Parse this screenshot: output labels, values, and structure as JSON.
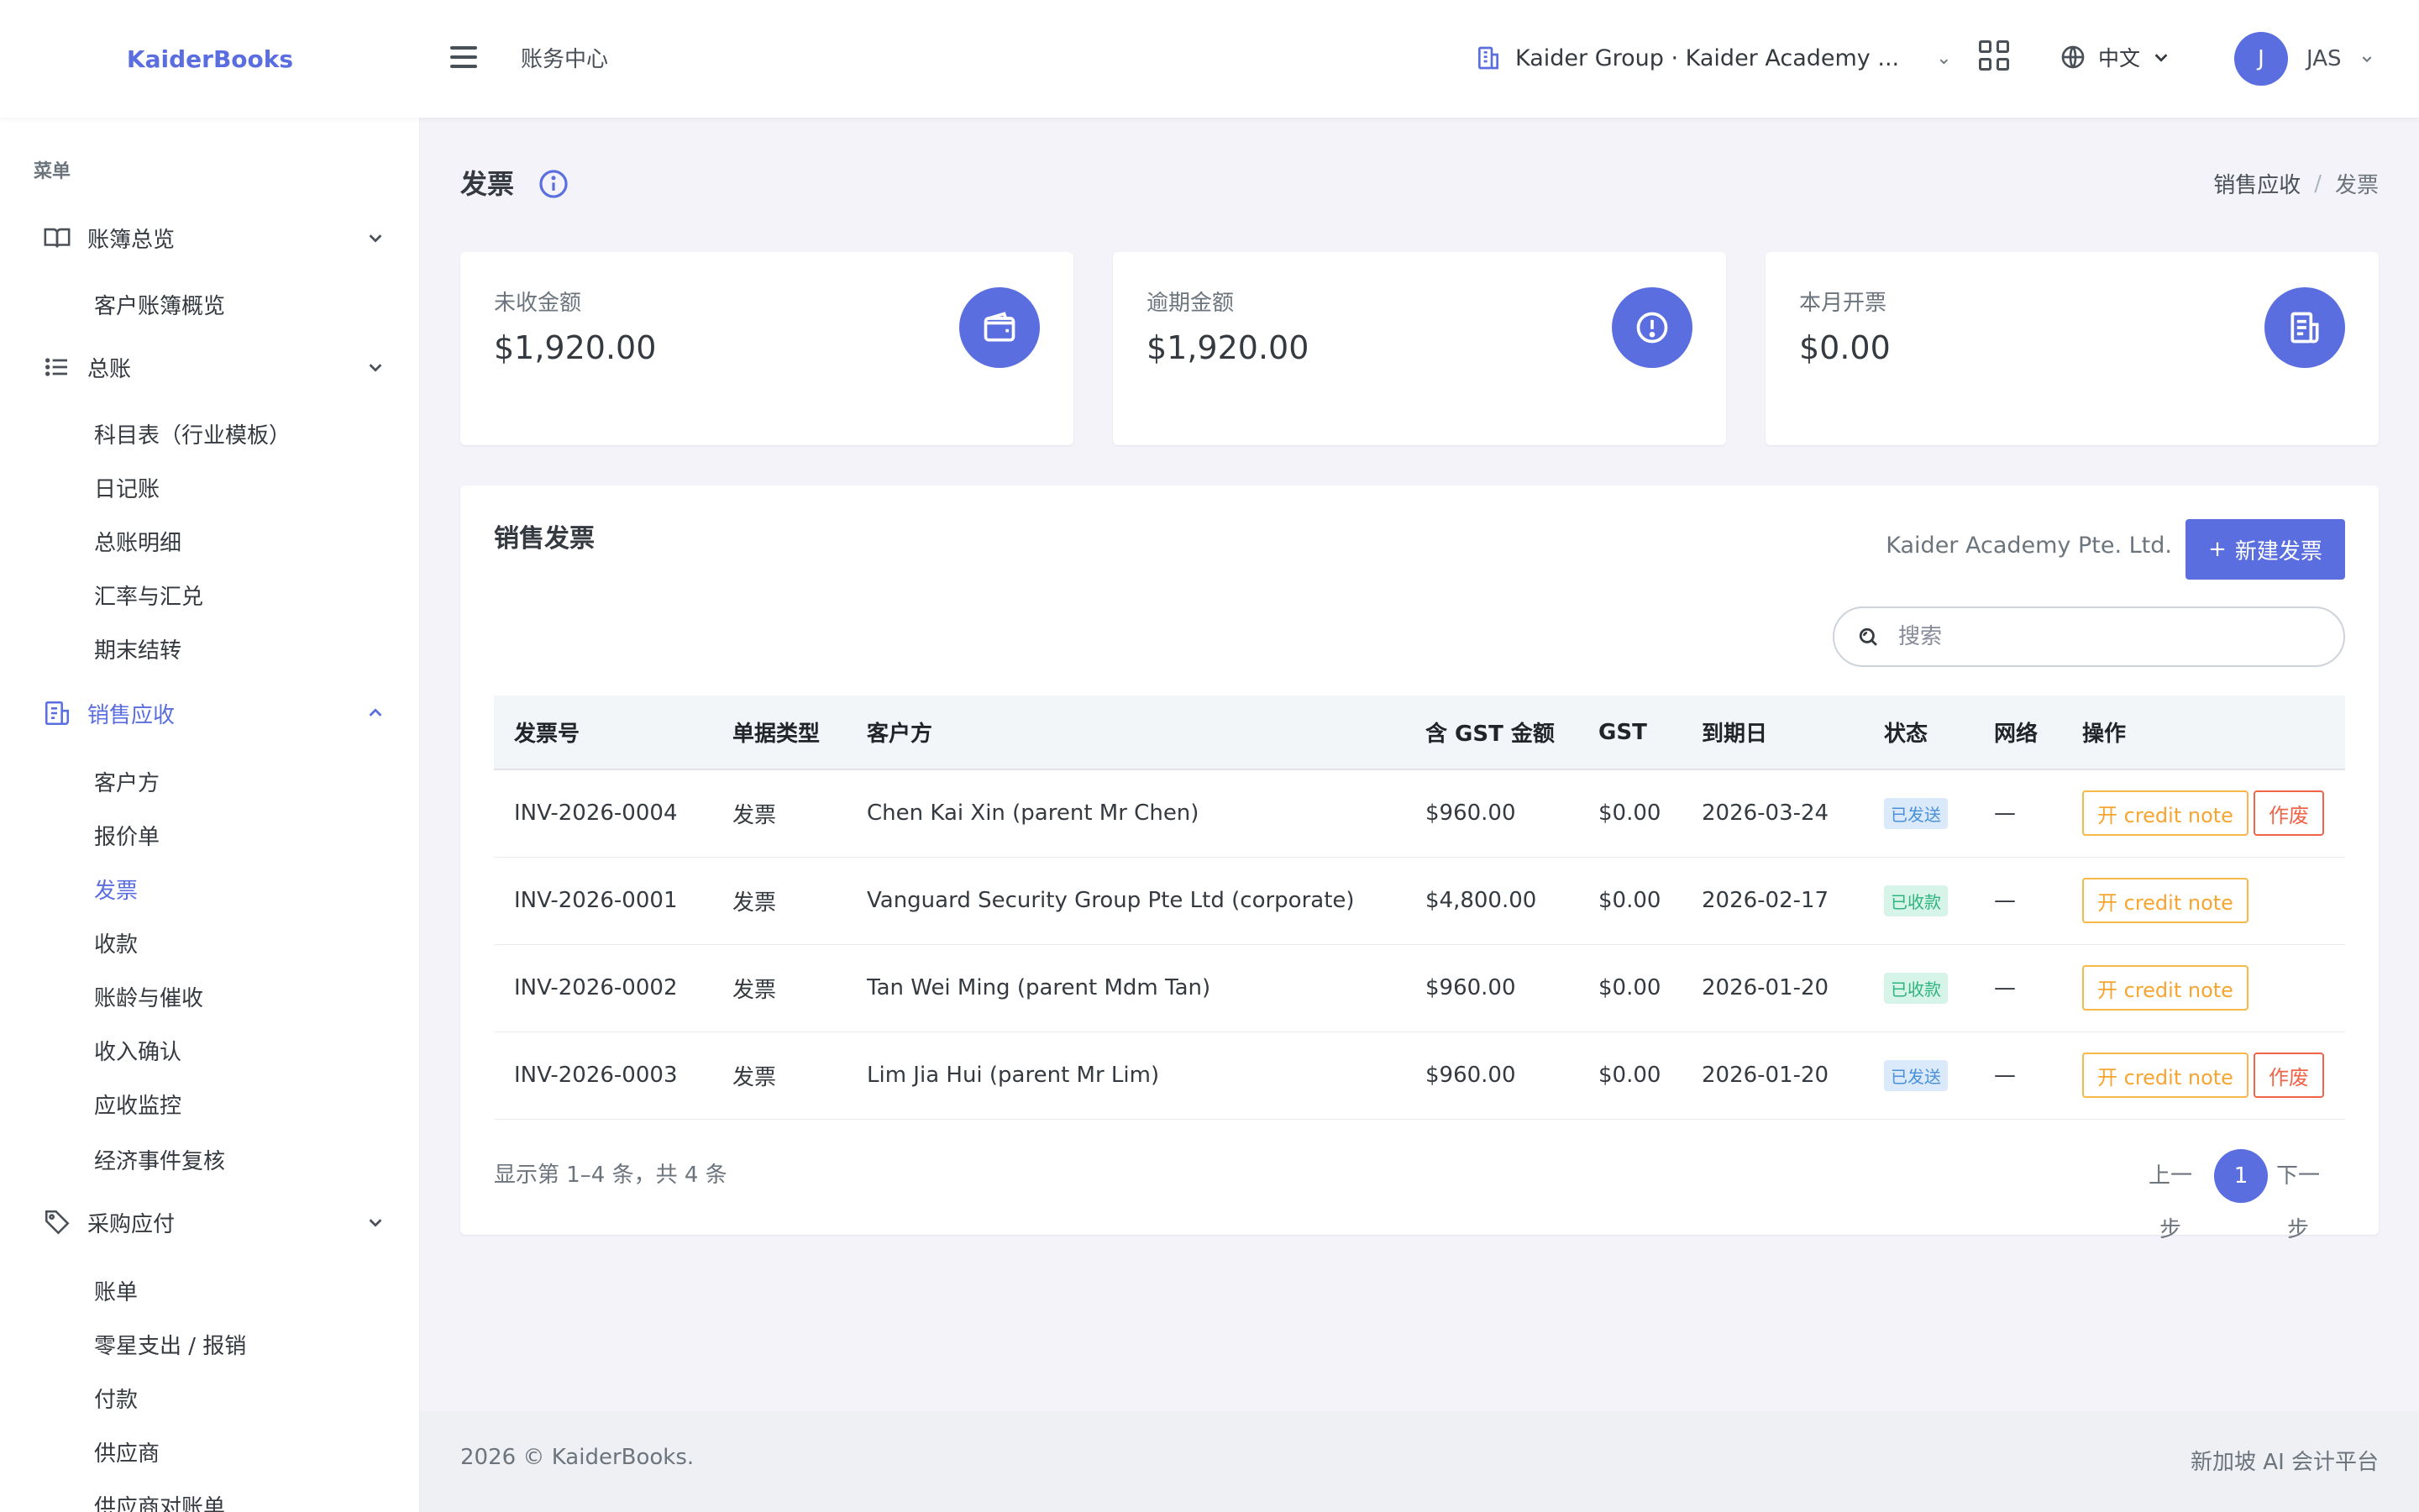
{
  "app": {
    "brand": "KaiderBooks",
    "top_title": "账务中心"
  },
  "header": {
    "org": "Kaider Group · Kaider Academy ...",
    "language": "中文",
    "user_initial": "J",
    "user_name": "JAS"
  },
  "sidebar": {
    "menu_title": "菜单",
    "groups": [
      {
        "label": "账簿总览",
        "icon": "book-open-icon",
        "items": [
          "客户账簿概览"
        ]
      },
      {
        "label": "总账",
        "icon": "list-icon",
        "items": [
          "科目表（行业模板）",
          "日记账",
          "总账明细",
          "汇率与汇兑",
          "期末结转"
        ]
      },
      {
        "label": "销售应收",
        "icon": "receipt-icon",
        "active": true,
        "items": [
          "客户方",
          "报价单",
          "发票",
          "收款",
          "账龄与催收",
          "收入确认",
          "应收监控",
          "经济事件复核"
        ]
      },
      {
        "label": "采购应付",
        "icon": "tag-icon",
        "items": [
          "账单",
          "零星支出 / 报销",
          "付款",
          "供应商",
          "供应商对账单"
        ]
      }
    ],
    "active_item": "发票"
  },
  "page": {
    "title": "发票",
    "breadcrumb": [
      "销售应收",
      "发票"
    ]
  },
  "stats": [
    {
      "label": "未收金额",
      "value": "$1,920.00",
      "icon": "wallet-icon"
    },
    {
      "label": "逾期金额",
      "value": "$1,920.00",
      "icon": "alert-circle-icon"
    },
    {
      "label": "本月开票",
      "value": "$0.00",
      "icon": "invoice-icon"
    }
  ],
  "table_card": {
    "title": "销售发票",
    "company": "Kaider Academy Pte. Ltd.",
    "new_button": "新建发票",
    "search_placeholder": "搜索",
    "columns": [
      "发票号",
      "单据类型",
      "客户方",
      "含 GST 金额",
      "GST",
      "到期日",
      "状态",
      "网络",
      "操作"
    ],
    "rows": [
      {
        "no": "INV-2026-0004",
        "type": "发票",
        "customer": "Chen Kai Xin (parent Mr Chen)",
        "amount": "$960.00",
        "gst": "$0.00",
        "due": "2026-03-24",
        "status": "已发送",
        "status_kind": "sent",
        "network": "—",
        "credit": "开 credit note",
        "void": "作废"
      },
      {
        "no": "INV-2026-0001",
        "type": "发票",
        "customer": "Vanguard Security Group Pte Ltd (corporate)",
        "amount": "$4,800.00",
        "gst": "$0.00",
        "due": "2026-02-17",
        "status": "已收款",
        "status_kind": "paid",
        "network": "—",
        "credit": "开 credit note",
        "void": ""
      },
      {
        "no": "INV-2026-0002",
        "type": "发票",
        "customer": "Tan Wei Ming (parent Mdm Tan)",
        "amount": "$960.00",
        "gst": "$0.00",
        "due": "2026-01-20",
        "status": "已收款",
        "status_kind": "paid",
        "network": "—",
        "credit": "开 credit note",
        "void": ""
      },
      {
        "no": "INV-2026-0003",
        "type": "发票",
        "customer": "Lim Jia Hui (parent Mr Lim)",
        "amount": "$960.00",
        "gst": "$0.00",
        "due": "2026-01-20",
        "status": "已发送",
        "status_kind": "sent",
        "network": "—",
        "credit": "开 credit note",
        "void": "作废"
      }
    ],
    "showing": "显示第 1–4 条，共 4 条",
    "pager": {
      "prev": "上一步",
      "current": "1",
      "next": "下一步"
    }
  },
  "footer": {
    "left": "2026 © KaiderBooks.",
    "right": "新加坡 AI 会计平台"
  },
  "colors": {
    "accent": "#5a6ee0",
    "warning": "#f7b84b",
    "danger": "#f06548",
    "success": "#2fb380",
    "info": "#4a90d9"
  }
}
